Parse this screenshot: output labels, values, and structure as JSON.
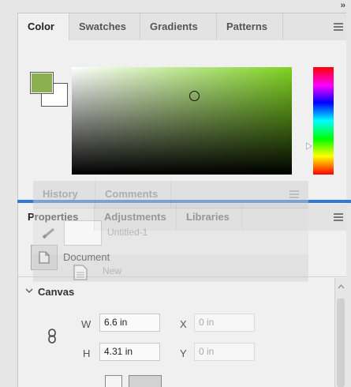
{
  "panel_collapse_icon": "double-chevron-right",
  "color_panel": {
    "tabs": [
      "Color",
      "Swatches",
      "Gradients",
      "Patterns"
    ],
    "active_tab": "Color",
    "foreground_color": "#8bb04f",
    "background_color": "#ffffff",
    "picker_hue": "#7ed321"
  },
  "properties_panel": {
    "tabs": [
      "Properties",
      "Adjustments",
      "Libraries"
    ],
    "active_tab": "Properties",
    "doc_type_label": "Document",
    "section_title": "Canvas",
    "width_label": "W",
    "width_value": "6.6 in",
    "height_label": "H",
    "height_value": "4.31 in",
    "x_label": "X",
    "x_value": "0 in",
    "y_label": "Y",
    "y_value": "0 in"
  },
  "dragged_panel": {
    "tabs": [
      "History",
      "Comments"
    ],
    "snapshot_name": "Untitled-1",
    "step_label": "New"
  }
}
